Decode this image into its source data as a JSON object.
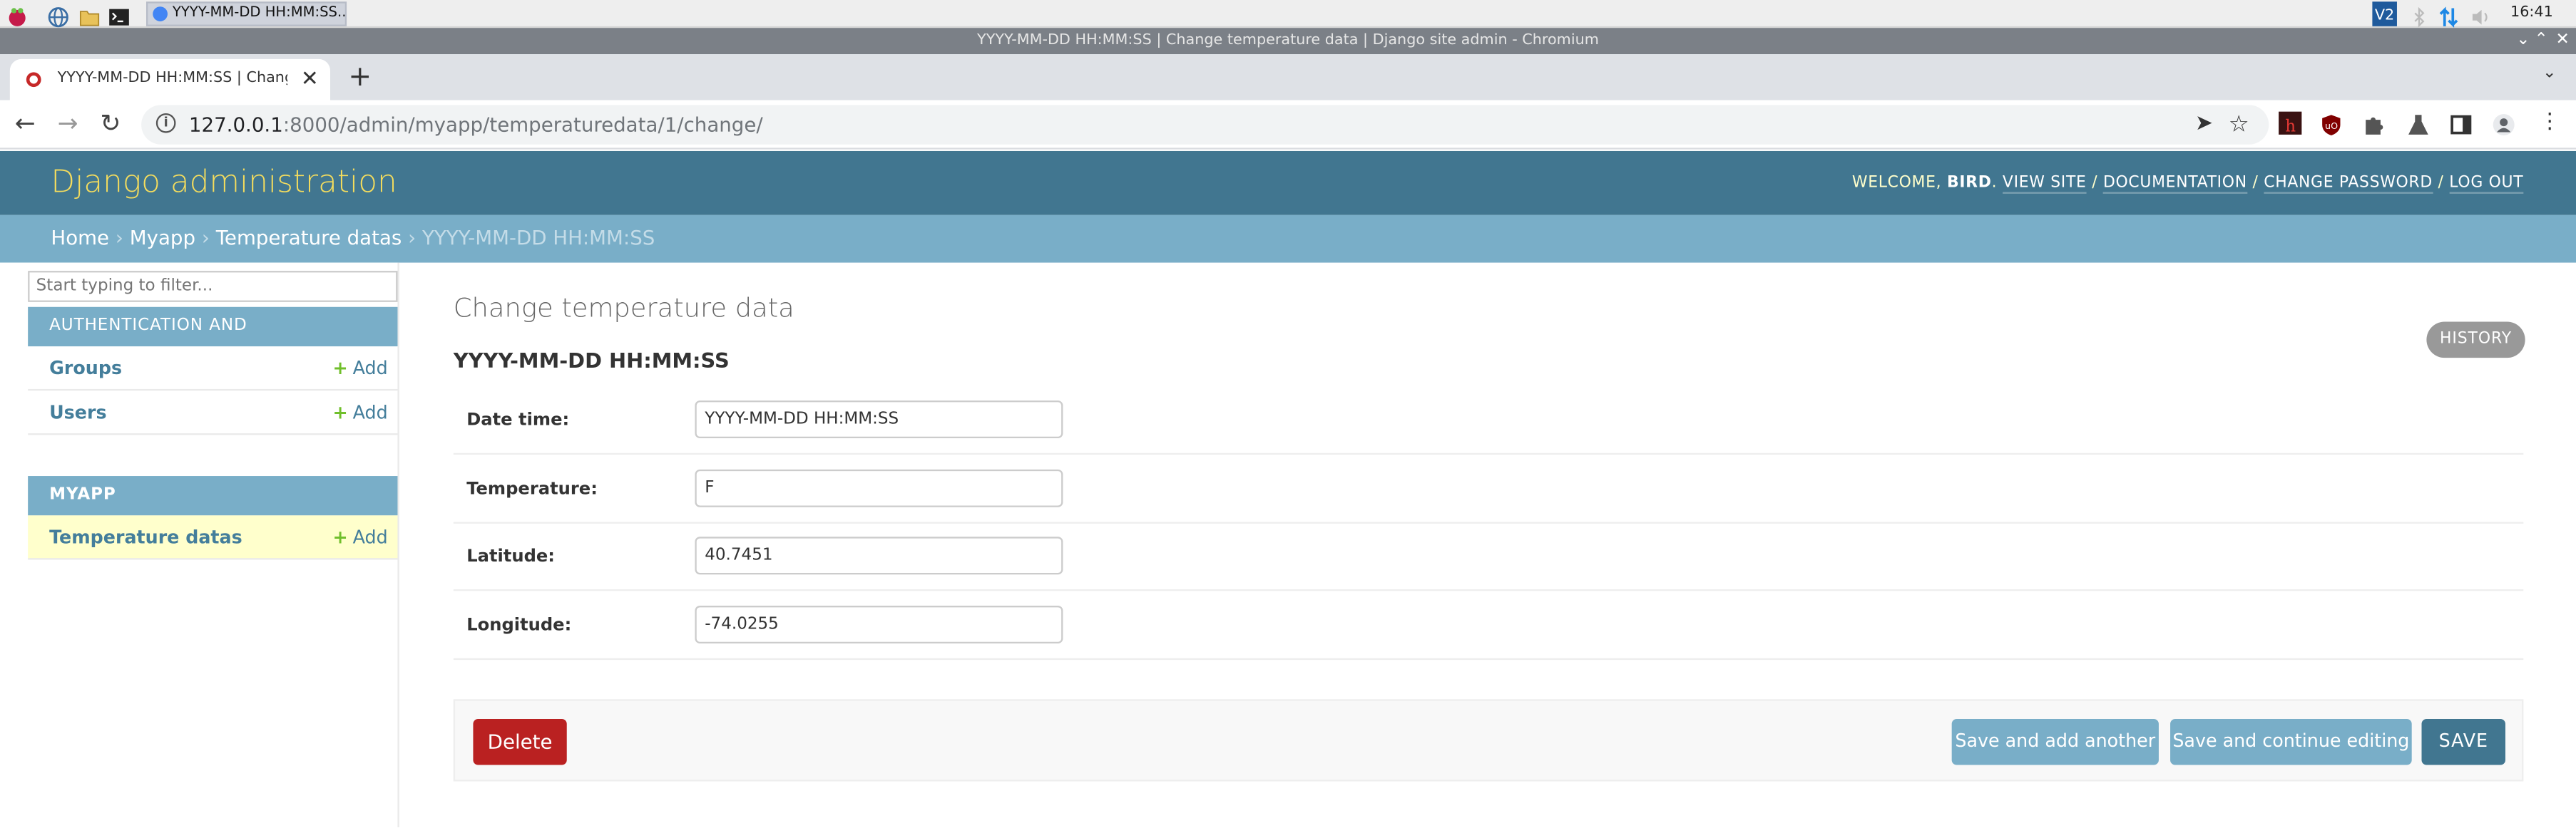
{
  "os": {
    "taskbar": {
      "app_icons": [
        "raspberry-menu-icon",
        "globe-icon",
        "folder-icon",
        "terminal-icon"
      ],
      "task_label": "YYYY-MM-DD HH:MM:SS...",
      "tray_icons": [
        "vnc-icon",
        "bluetooth-icon",
        "network-icon",
        "volume-icon"
      ],
      "clock": "16:41"
    },
    "window_title": "YYYY-MM-DD HH:MM:SS | Change temperature data | Django site admin - Chromium"
  },
  "browser": {
    "tab": {
      "title": "YYYY-MM-DD HH:MM:SS | Change temperature data | Django site admin"
    },
    "url_host": "127.0.0.1",
    "url_rest": ":8000/admin/myapp/temperaturedata/1/change/",
    "extension_icons": [
      "red-extension-icon",
      "ublock-icon",
      "puzzle-icon",
      "flask-icon",
      "sidepanel-icon",
      "profile-icon",
      "kebab-menu-icon"
    ]
  },
  "admin": {
    "branding": "Django administration",
    "user_tools": {
      "welcome": "WELCOME,",
      "username": "BIRD",
      "view_site": "VIEW SITE",
      "documentation": "DOCUMENTATION",
      "change_password": "CHANGE PASSWORD",
      "log_out": "LOG OUT",
      "separator": "/"
    },
    "breadcrumbs": {
      "home": "Home",
      "app": "Myapp",
      "model": "Temperature datas",
      "current": "YYYY-MM-DD HH:MM:SS",
      "separator": "›"
    },
    "sidebar": {
      "filter_placeholder": "Start typing to filter...",
      "add_label": "Add",
      "modules": [
        {
          "caption": "AUTHENTICATION AND AUTHORIZATION",
          "models": [
            {
              "name": "Groups"
            },
            {
              "name": "Users"
            }
          ]
        },
        {
          "caption": "MYAPP",
          "models": [
            {
              "name": "Temperature datas",
              "active": true
            }
          ]
        }
      ]
    },
    "page_title": "Change temperature data",
    "object_title": "YYYY-MM-DD HH:MM:SS",
    "history_button": "HISTORY",
    "fields": [
      {
        "label": "Date time:",
        "value": "YYYY-MM-DD HH:MM:SS"
      },
      {
        "label": "Temperature:",
        "value": "F"
      },
      {
        "label": "Latitude:",
        "value": "40.7451"
      },
      {
        "label": "Longitude:",
        "value": "-74.0255"
      }
    ],
    "buttons": {
      "delete": "Delete",
      "save_add_another": "Save and add another",
      "save_continue": "Save and continue editing",
      "save": "SAVE"
    }
  },
  "colors": {
    "header": "#417690",
    "breadcrumbs": "#79aec8",
    "branding_text": "#f5dd5d",
    "link": "#447e9b",
    "delete": "#ba2121",
    "save": "#417690",
    "secondary_button": "#79aec8",
    "active_row": "#ffffcc"
  }
}
